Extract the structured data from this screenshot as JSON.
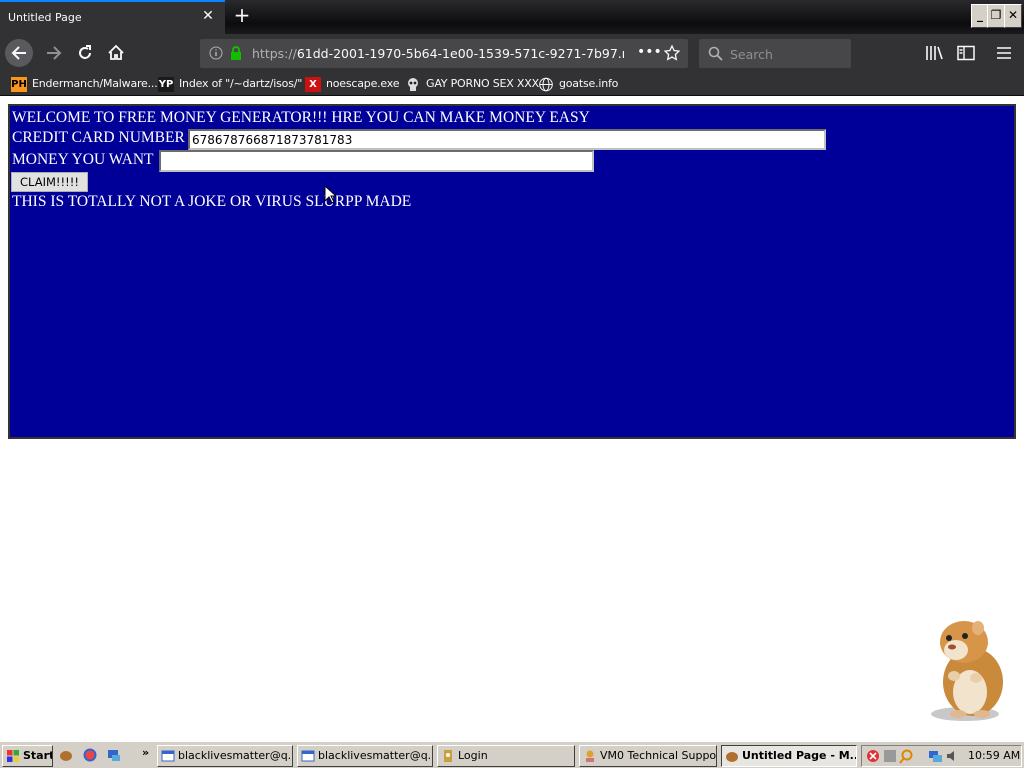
{
  "browser": {
    "tab_title": "Untitled Page",
    "url_prefix": "https://",
    "url_host": "61dd-2001-1970-5b64-1e00-1539-571c-9271-7b97.n",
    "search_placeholder": "Search"
  },
  "bookmarks": [
    {
      "icon_text": "PH",
      "label": "Endermanch/Malware..."
    },
    {
      "icon_text": "YP",
      "label": "Index of \"/~dartz/isos/\""
    },
    {
      "icon_text": "X",
      "label": "noescape.exe"
    },
    {
      "icon_text": "",
      "label": "GAY PORNO SEX XXX"
    },
    {
      "icon_text": "",
      "label": "goatse.info"
    }
  ],
  "page": {
    "welcome": "WELCOME TO FREE MONEY GENERATOR!!! HRE YOU CAN MAKE MONEY EASY",
    "cc_label": "CREDIT CARD NUMBER",
    "cc_value": "67867876687187378178​3",
    "money_label": "MONEY YOU WANT",
    "money_value": "",
    "claim_label": "CLAIM!!!!!",
    "disclaimer": "THIS IS TOTALLY NOT A JOKE OR VIRUS SLURPP MADE",
    "background_color": "#000099"
  },
  "taskbar": {
    "start_label": "Start",
    "tasks": [
      {
        "label": "blacklivesmatter@q..."
      },
      {
        "label": "blacklivesmatter@q..."
      },
      {
        "label": "Login"
      },
      {
        "label": "VM0 Technical Support"
      },
      {
        "label": "Untitled Page - M..."
      }
    ],
    "clock": "10:59 AM"
  }
}
